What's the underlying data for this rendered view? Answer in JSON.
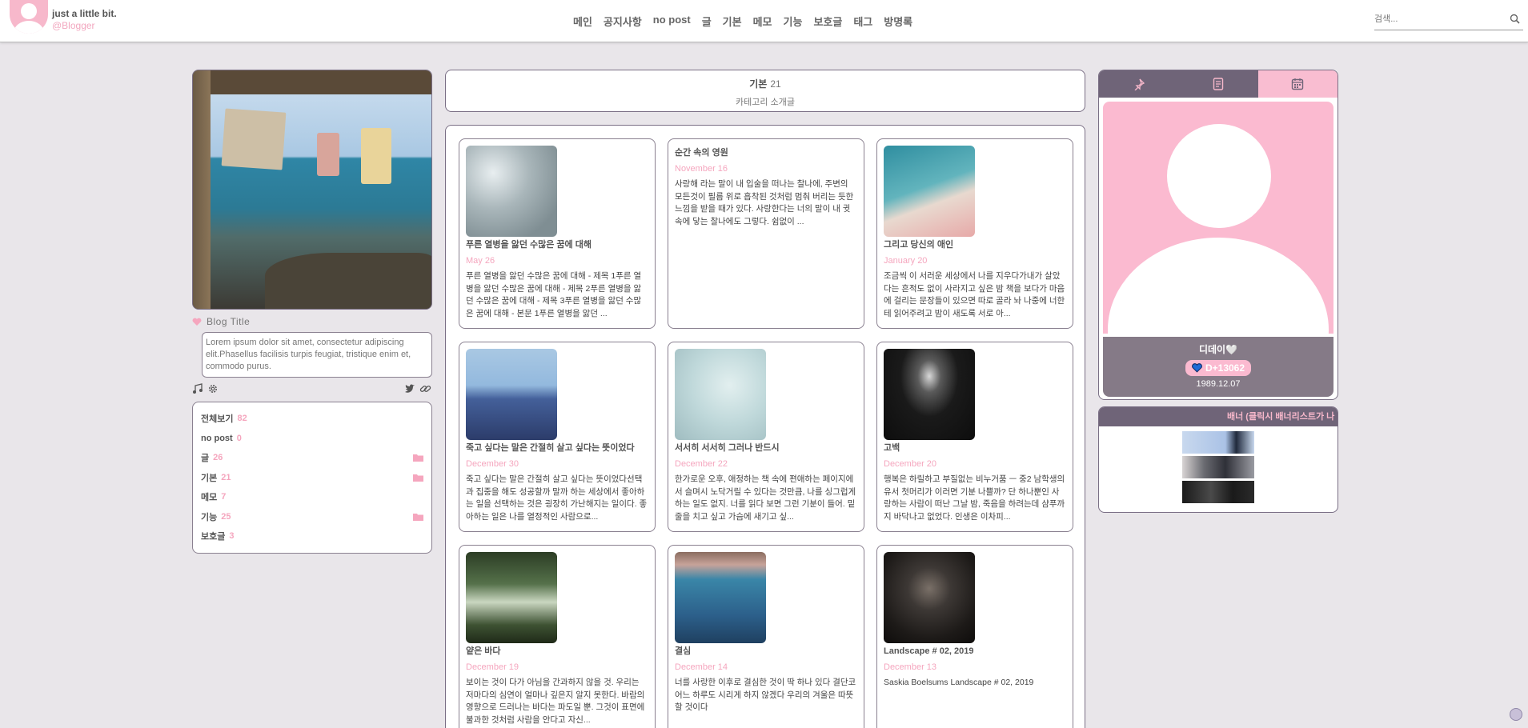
{
  "header": {
    "brand_title": "just a little bit.",
    "brand_sub": "@Blogger",
    "nav": [
      "메인",
      "공지사항",
      "no post",
      "글",
      "기본",
      "메모",
      "기능",
      "보호글",
      "태그",
      "방명록"
    ],
    "search_placeholder": "검색..."
  },
  "left": {
    "blog_title": "Blog Title",
    "description": "Lorem ipsum dolor sit amet, consectetur adipiscing elit.Phasellus facilisis turpis feugiat, tristique enim et, commodo purus.",
    "categories": [
      {
        "label": "전체보기",
        "count": "82"
      },
      {
        "label": "no post",
        "count": "0"
      },
      {
        "label": "글",
        "count": "26"
      },
      {
        "label": "기본",
        "count": "21"
      },
      {
        "label": "메모",
        "count": "7"
      },
      {
        "label": "기능",
        "count": "25"
      },
      {
        "label": "보호글",
        "count": "3"
      }
    ]
  },
  "category_header": {
    "name": "기본",
    "count": "21",
    "subtitle": "카테고리 소개글"
  },
  "posts": [
    {
      "title": "푸른 열병을 앓던 수많은 꿈에 대해",
      "date": "May 26",
      "excerpt": "푸른 열병을 앓던 수많은 꿈에 대해 - 제목 1푸른 열병을 앓던 수많은 꿈에 대해 - 제목 2푸른 열병을 앓던 수많은 꿈에 대해 - 제목 3푸른 열병을 앓던 수많은 꿈에 대해 - 본문 1푸른 열병을 앓던 ..."
    },
    {
      "title": "순간 속의 영원",
      "date": "November 16",
      "excerpt": "사랑해 라는 말이 내 입술을 떠나는 찰나에, 주변의 모든것이 필름 위로 흡착된 것처럼 멈춰 버리는 듯한 느낌을 받을 때가 있다. 사랑한다는 너의 말이 내 귓속에 닿는 찰나에도 그렇다. 쉼없이 ..."
    },
    {
      "title": "그리고 당신의 애인",
      "date": "January 20",
      "excerpt": "조금씩 이 서러운 세상에서 나를 지우다가내가 살았다는 흔적도 없이 사라지고 싶은 밤 책을 보다가 마음에 걸리는 문장들이 있으면 따로 골라 놔 나중에 너한테 읽어주려고 밤이 새도록 서로 아..."
    },
    {
      "title": "죽고 싶다는 말은 간절히 살고 싶다는 뜻이었다",
      "date": "December 30",
      "excerpt": "죽고 싶다는 말은 간절히 살고 싶다는 뜻이었다선택과 집중을 해도 성공할까 말까 하는 세상에서 좋아하는 일을 선택하는 것은 굉장히 가난해지는 일이다. 좋아하는 일은 나를 열정적인 사람으로..."
    },
    {
      "title": "서서히 서서히 그러나 반드시",
      "date": "December 22",
      "excerpt": "한가로운 오후, 애정하는 책 속에 편애하는 페이지에서 슬며시 노닥거릴 수 있다는 것만큼, 나를 싱그럽게 하는 일도 없지. 너를 읽다 보면 그런 기분이 들어. 밑줄을 치고 싶고 가슴에 새기고 싶..."
    },
    {
      "title": "고백",
      "date": "December 20",
      "excerpt": "행복은 하릴하고 부질없는 비누거품 ㅡ 중2 남학생의 유서 첫머리가 이러면 기분 나쁠까? 단 하나뿐인 사랑하는 사람이 떠난 그날 밤, 죽음을 하려는데 샴푸까지 바닥나고 없었다. 인생은 이차피..."
    },
    {
      "title": "얕은 바다",
      "date": "December 19",
      "excerpt": "보이는 것이 다가 아님을 간과하지 않을 것. 우리는 저마다의 심연이 얼마나 깊은지 알지 못한다. 바람의 영향으로 드러나는 바다는 파도일 뿐. 그것이 표면에 불과한 것처럼 사람을 안다고 자신..."
    },
    {
      "title": "결심",
      "date": "December 14",
      "excerpt": "너를 사랑한 이후로 결심한 것이 딱 하나 있다 결단코 어느 하루도 시리게 하지 않겠다 우리의 겨울은 따뜻할 것이다"
    },
    {
      "title": "Landscape # 02, 2019",
      "date": "December 13",
      "excerpt": "Saskia Boelsums Landscape # 02, 2019"
    }
  ],
  "profile": {
    "name": "디데이🤍",
    "dday": "D+13062",
    "birth": "1989.12.07"
  },
  "banner": {
    "title": "배너 (클릭시 배너리스트가 나"
  },
  "colors": {
    "accent_pink": "#f5a6be",
    "panel_purple": "#6f6478",
    "border": "#7a6f85"
  }
}
